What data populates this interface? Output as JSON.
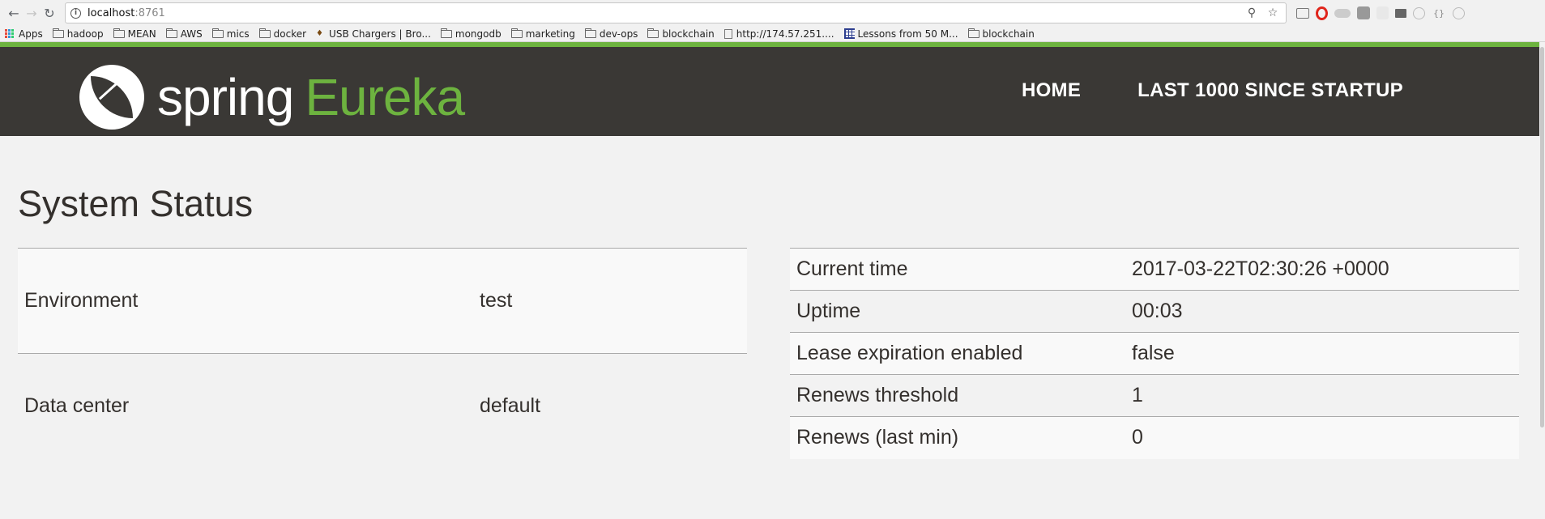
{
  "browser": {
    "url_host": "localhost",
    "url_port": ":8761",
    "bookmarks": [
      {
        "label": "Apps",
        "icon": "apps-icon"
      },
      {
        "label": "hadoop",
        "icon": "folder-icon"
      },
      {
        "label": "MEAN",
        "icon": "folder-icon"
      },
      {
        "label": "AWS",
        "icon": "folder-icon"
      },
      {
        "label": "mics",
        "icon": "folder-icon"
      },
      {
        "label": "docker",
        "icon": "folder-icon"
      },
      {
        "label": "USB Chargers | Bro...",
        "icon": "usb-icon"
      },
      {
        "label": "mongodb",
        "icon": "folder-icon"
      },
      {
        "label": "marketing",
        "icon": "folder-icon"
      },
      {
        "label": "dev-ops",
        "icon": "folder-icon"
      },
      {
        "label": "blockchain",
        "icon": "folder-icon"
      },
      {
        "label": "http://174.57.251....",
        "icon": "page-icon"
      },
      {
        "label": "Lessons from 50 M...",
        "icon": "grid-icon"
      },
      {
        "label": "blockchain",
        "icon": "folder-icon"
      }
    ]
  },
  "header": {
    "logo_word1": "spring",
    "logo_word2": "Eureka",
    "nav": [
      {
        "label": "HOME"
      },
      {
        "label": "LAST 1000 SINCE STARTUP"
      }
    ],
    "colors": {
      "bar": "#3a3835",
      "accent": "#6db33f"
    }
  },
  "page": {
    "title": "System Status",
    "left_table": [
      {
        "key": "Environment",
        "value": "test"
      },
      {
        "key": "Data center",
        "value": "default"
      }
    ],
    "right_table": [
      {
        "key": "Current time",
        "value": "2017-03-22T02:30:26 +0000"
      },
      {
        "key": "Uptime",
        "value": "00:03"
      },
      {
        "key": "Lease expiration enabled",
        "value": "false"
      },
      {
        "key": "Renews threshold",
        "value": "1"
      },
      {
        "key": "Renews (last min)",
        "value": "0"
      }
    ]
  }
}
